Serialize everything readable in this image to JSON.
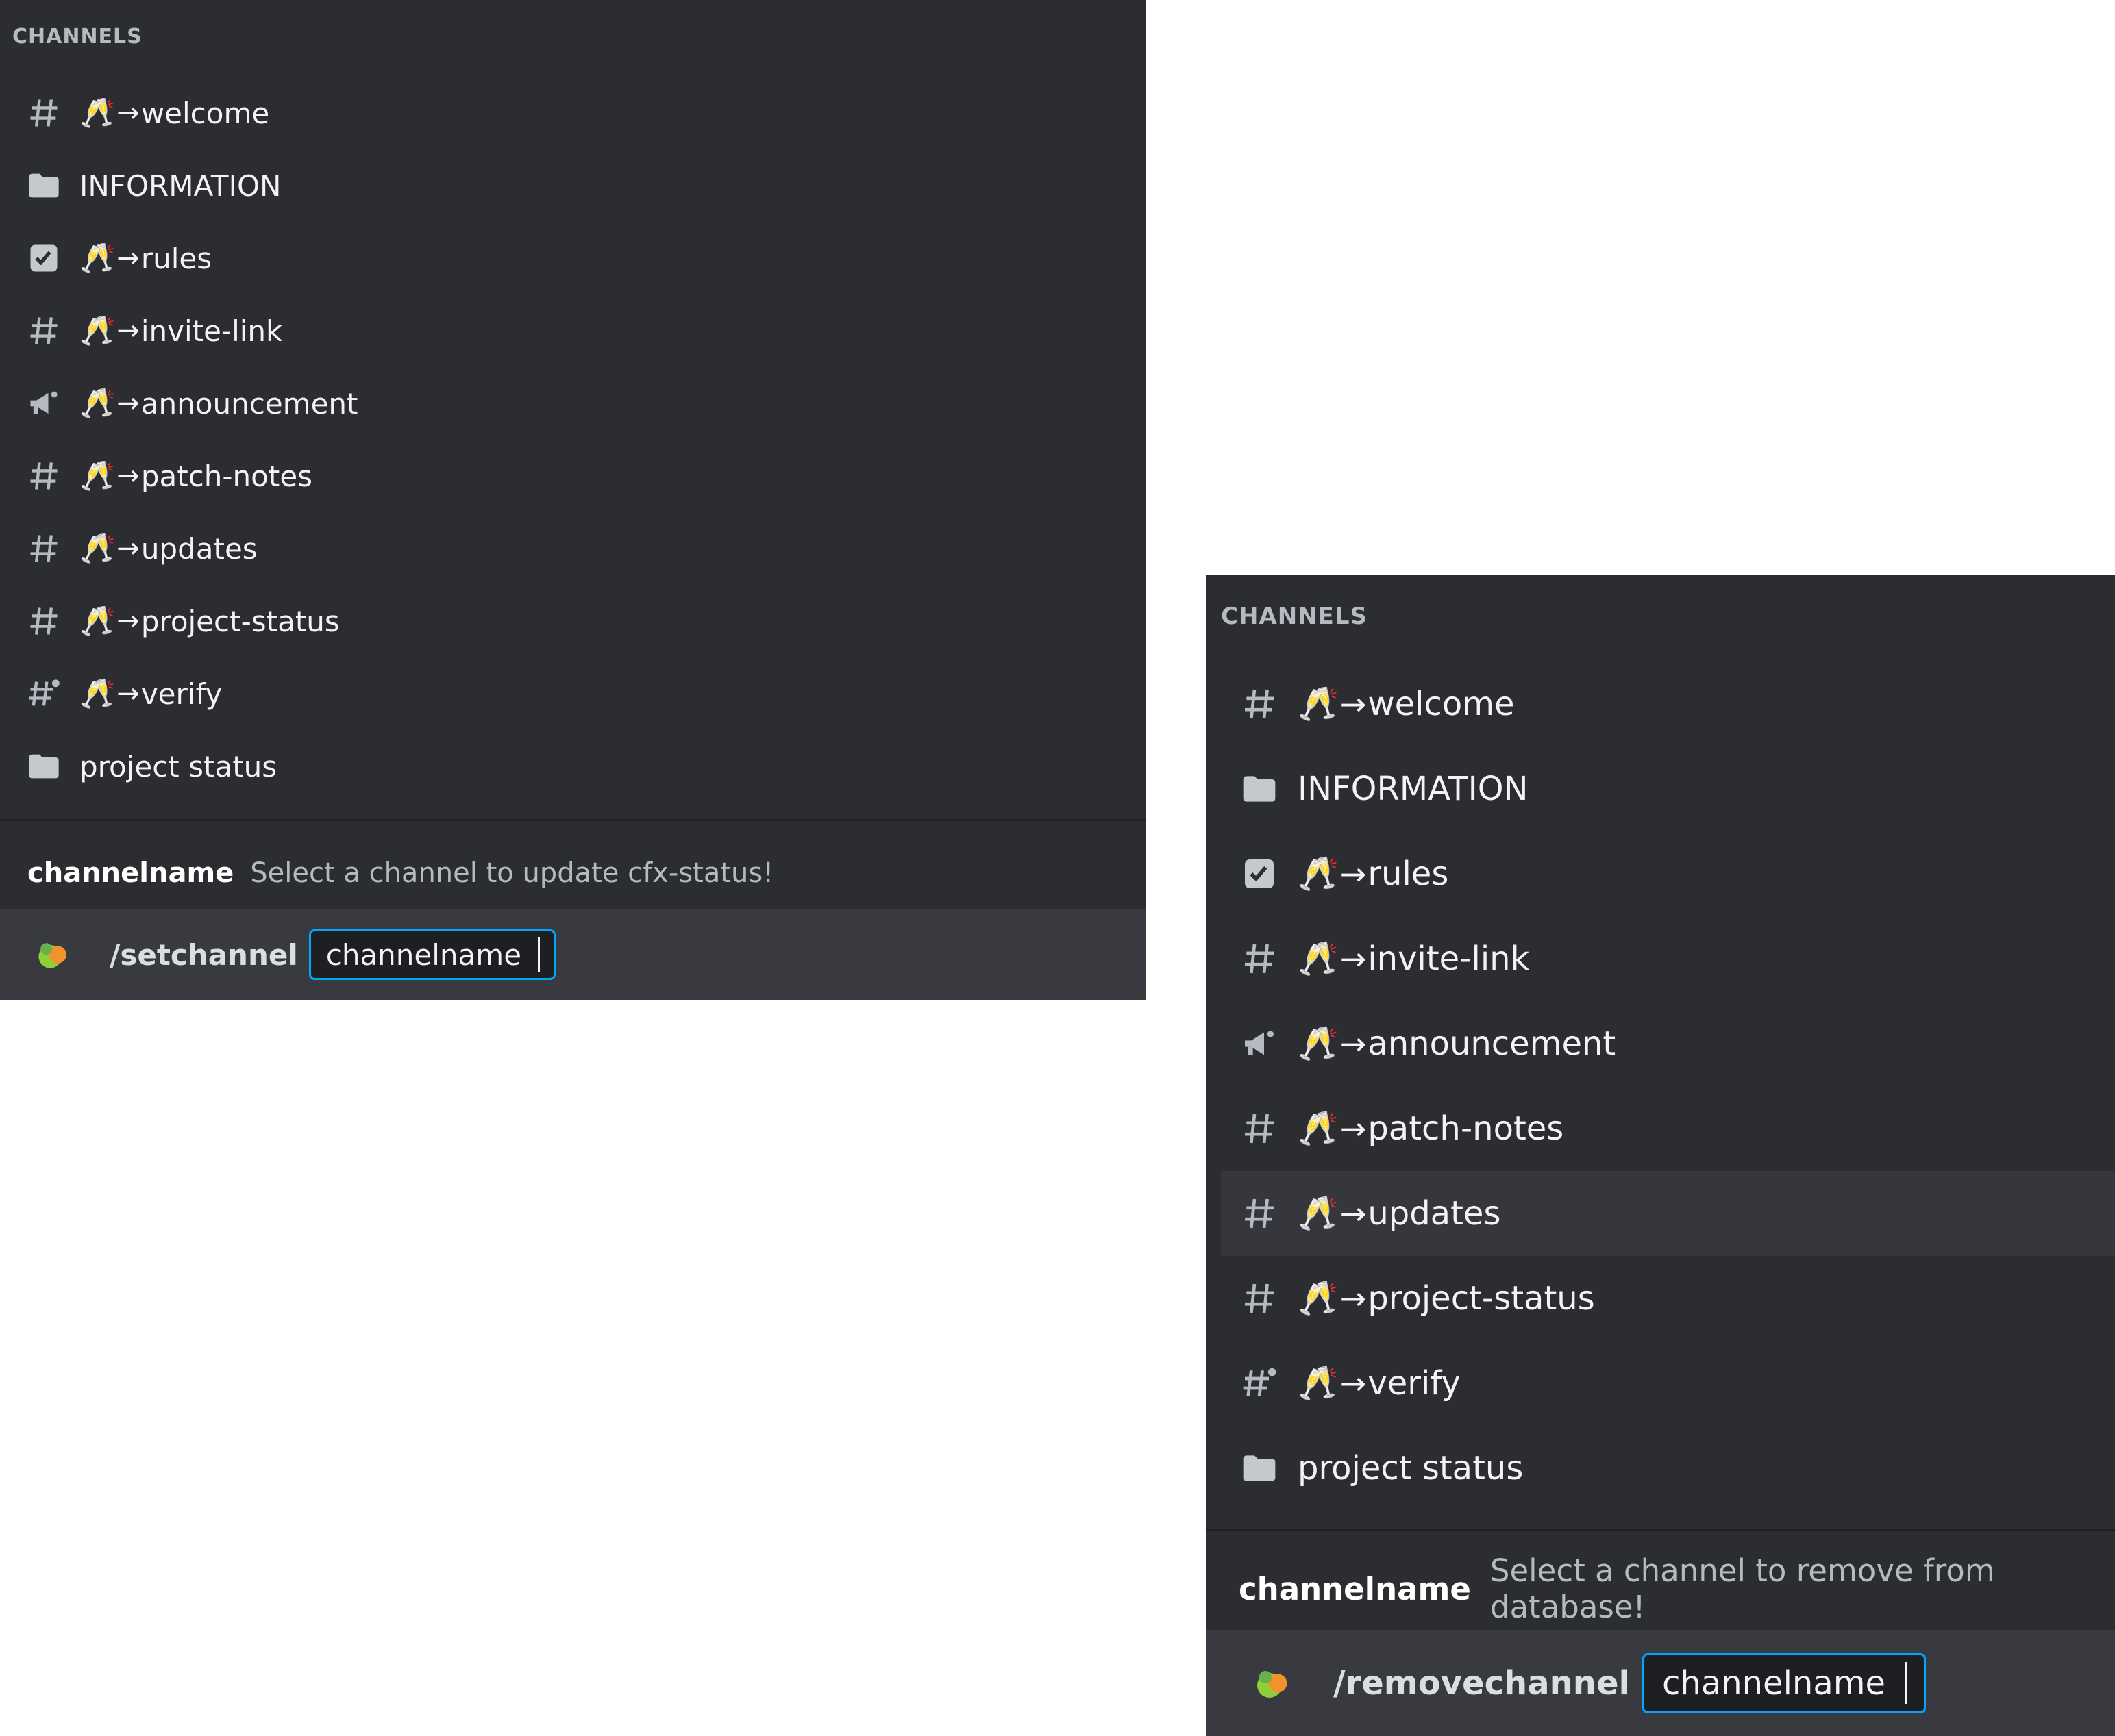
{
  "colors": {
    "panel_bg": "#2b2d31",
    "text_primary": "#f2f3f5",
    "text_muted": "#b5bac1",
    "input_border": "#00a8fc",
    "hover_row": "#35373c",
    "command_bar": "#383a40"
  },
  "left_panel": {
    "header": "CHANNELS",
    "channels": [
      {
        "icon": "text-channel-hash-icon",
        "emoji": "🥂",
        "arrow": "→",
        "name": "welcome"
      },
      {
        "icon": "folder-icon",
        "emoji": "",
        "arrow": "",
        "name": "INFORMATION"
      },
      {
        "icon": "rules-checkbox-icon",
        "emoji": "🥂",
        "arrow": "→",
        "name": "rules"
      },
      {
        "icon": "text-channel-hash-icon",
        "emoji": "🥂",
        "arrow": "→",
        "name": "invite-link"
      },
      {
        "icon": "announcement-megaphone-icon",
        "emoji": "🥂",
        "arrow": "→",
        "name": "announcement"
      },
      {
        "icon": "text-channel-hash-icon",
        "emoji": "🥂",
        "arrow": "→",
        "name": "patch-notes"
      },
      {
        "icon": "text-channel-hash-icon",
        "emoji": "🥂",
        "arrow": "→",
        "name": "updates"
      },
      {
        "icon": "text-channel-hash-icon",
        "emoji": "🥂",
        "arrow": "→",
        "name": "project-status"
      },
      {
        "icon": "locked-hash-icon",
        "emoji": "🥂",
        "arrow": "→",
        "name": "verify"
      },
      {
        "icon": "folder-icon",
        "emoji": "",
        "arrow": "",
        "name": "project status"
      }
    ],
    "option_hint": {
      "name": "channelname",
      "description": "Select a channel to update cfx-status!"
    },
    "command": {
      "app_icon": "bot-app-icon",
      "name": "/setchannel",
      "argument": "channelname"
    }
  },
  "right_panel": {
    "header": "CHANNELS",
    "channels": [
      {
        "icon": "text-channel-hash-icon",
        "emoji": "🥂",
        "arrow": "→",
        "name": "welcome"
      },
      {
        "icon": "folder-icon",
        "emoji": "",
        "arrow": "",
        "name": "INFORMATION"
      },
      {
        "icon": "rules-checkbox-icon",
        "emoji": "🥂",
        "arrow": "→",
        "name": "rules"
      },
      {
        "icon": "text-channel-hash-icon",
        "emoji": "🥂",
        "arrow": "→",
        "name": "invite-link"
      },
      {
        "icon": "announcement-megaphone-icon",
        "emoji": "🥂",
        "arrow": "→",
        "name": "announcement"
      },
      {
        "icon": "text-channel-hash-icon",
        "emoji": "🥂",
        "arrow": "→",
        "name": "patch-notes"
      },
      {
        "icon": "text-channel-hash-icon",
        "emoji": "🥂",
        "arrow": "→",
        "name": "updates"
      },
      {
        "icon": "text-channel-hash-icon",
        "emoji": "🥂",
        "arrow": "→",
        "name": "project-status"
      },
      {
        "icon": "locked-hash-icon",
        "emoji": "🥂",
        "arrow": "→",
        "name": "verify"
      },
      {
        "icon": "folder-icon",
        "emoji": "",
        "arrow": "",
        "name": "project status"
      }
    ],
    "hovered_channel": "updates",
    "option_hint": {
      "name": "channelname",
      "description": "Select a channel to remove from database!"
    },
    "command": {
      "app_icon": "bot-app-icon",
      "name": "/removechannel",
      "argument": "channelname"
    }
  }
}
